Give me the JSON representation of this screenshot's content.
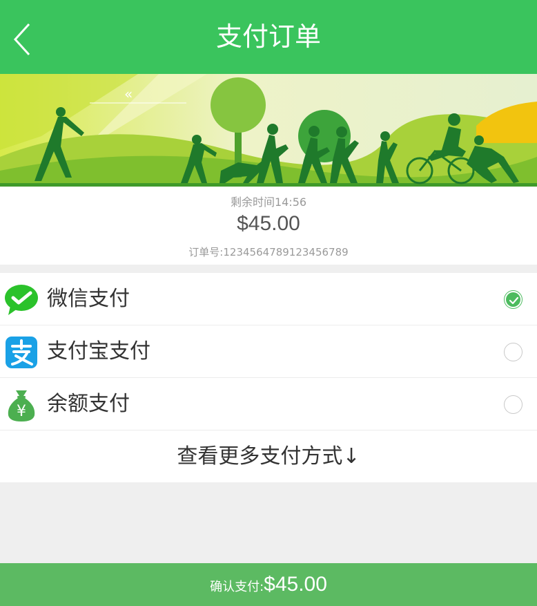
{
  "header": {
    "title": "支付订单"
  },
  "order": {
    "remaining": "剩余时间14:56",
    "amount": "$45.00",
    "order_no": "订单号:1234564789123456789"
  },
  "methods": [
    {
      "label": "微信支付",
      "icon": "wechat-pay-icon",
      "selected": true
    },
    {
      "label": "支付宝支付",
      "icon": "alipay-icon",
      "selected": false
    },
    {
      "label": "余额支付",
      "icon": "money-bag-icon",
      "selected": false
    }
  ],
  "more_label": "查看更多支付方式↓",
  "footer": {
    "label": "确认支付:",
    "amount": "$45.00"
  },
  "colors": {
    "primary_green": "#3ac45d",
    "footer_green": "#5cba62",
    "alipay_blue": "#1aa1e6",
    "wechat_green": "#2bc22b"
  }
}
